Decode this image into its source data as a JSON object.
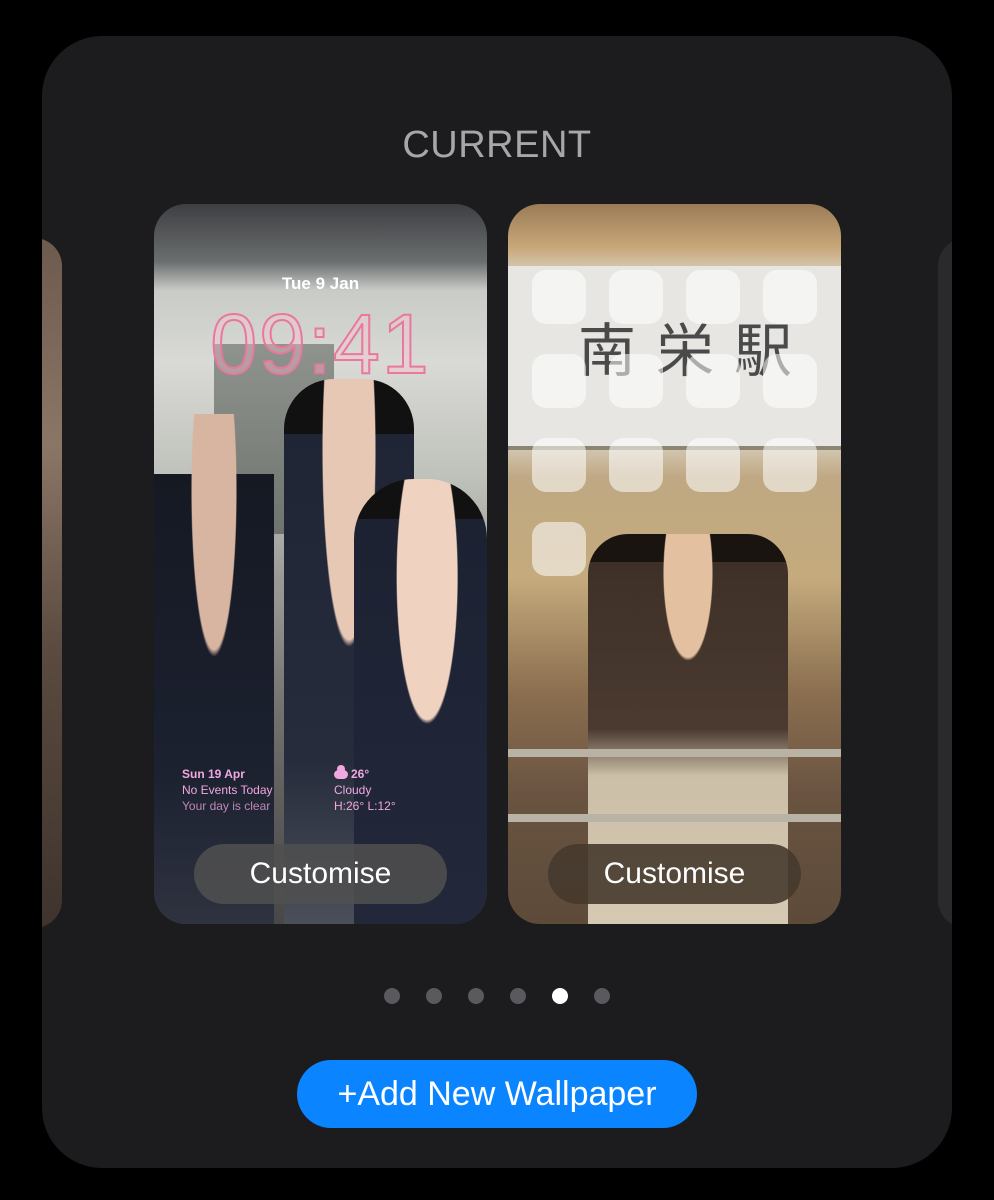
{
  "header": {
    "title": "CURRENT"
  },
  "lock_screen": {
    "date": "Tue 9 Jan",
    "time": "09:41",
    "calendar_widget": {
      "date": "Sun 19 Apr",
      "line1": "No Events Today",
      "line2": "Your day is clear"
    },
    "weather_widget": {
      "temp": "26°",
      "condition": "Cloudy",
      "range": "H:26° L:12°",
      "icon": "cloud-icon"
    },
    "customise_label": "Customise"
  },
  "home_screen": {
    "sign_text": "南栄駅",
    "customise_label": "Customise",
    "app_slot_rows": [
      4,
      4,
      4,
      1
    ]
  },
  "pagination": {
    "count": 6,
    "active_index": 4
  },
  "add_button": {
    "label": "Add New Wallpaper",
    "icon": "plus-icon"
  },
  "colors": {
    "accent": "#0a84ff",
    "sheet_background": "#1c1c1e",
    "clock_tint": "#e8789e",
    "widget_tint": "#f0a8e0"
  }
}
